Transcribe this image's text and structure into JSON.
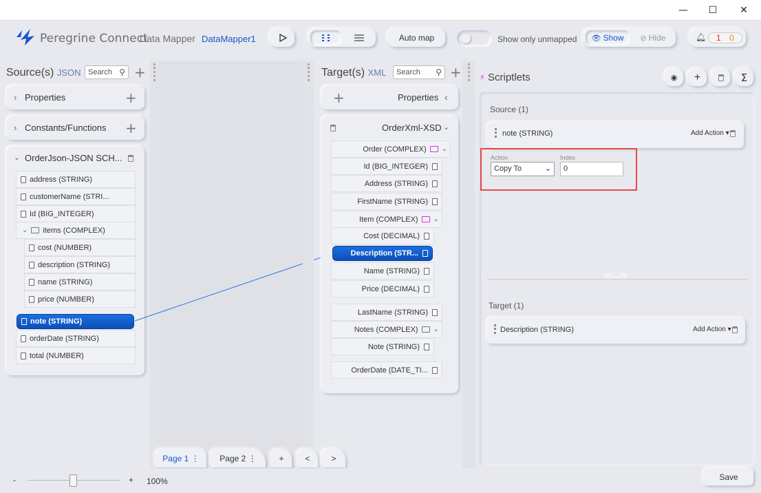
{
  "app": {
    "name": "Peregrine Connect",
    "module": "Data Mapper",
    "mapper_name": "DataMapper1"
  },
  "window_controls": {
    "minimize": "—",
    "maximize": "☐",
    "close": "✕"
  },
  "toolbar": {
    "auto_map_label": "Auto map",
    "show_only_unmapped_label": "Show only unmapped",
    "show_label": "Show",
    "hide_label": "Hide",
    "notif_red_count": "1",
    "notif_orange_count": "0"
  },
  "source": {
    "title": "Source(s)",
    "format": "JSON",
    "search_placeholder": "Search",
    "properties_label": "Properties",
    "constants_label": "Constants/Functions",
    "schema_label": "OrderJson-JSON SCH...",
    "items": [
      {
        "label": "address (STRING)"
      },
      {
        "label": "customerName (STRI..."
      },
      {
        "label": "Id (BIG_INTEGER)"
      },
      {
        "label": "items (COMPLEX)"
      },
      {
        "label": "cost (NUMBER)"
      },
      {
        "label": "description (STRING)"
      },
      {
        "label": "name (STRING)"
      },
      {
        "label": "price (NUMBER)"
      },
      {
        "label": "note (STRING)"
      },
      {
        "label": "orderDate (STRING)"
      },
      {
        "label": "total (NUMBER)"
      }
    ]
  },
  "target": {
    "title": "Target(s)",
    "format": "XML",
    "search_placeholder": "Search",
    "properties_label": "Properties",
    "schema_label": "OrderXml-XSD",
    "items": [
      {
        "label": "Order (COMPLEX)"
      },
      {
        "label": "Id (BIG_INTEGER)"
      },
      {
        "label": "Address (STRING)"
      },
      {
        "label": "FirstName (STRING)"
      },
      {
        "label": "Item (COMPLEX)"
      },
      {
        "label": "Cost (DECIMAL)"
      },
      {
        "label": "Description (STR..."
      },
      {
        "label": "Name (STRING)"
      },
      {
        "label": "Price (DECIMAL)"
      },
      {
        "label": "LastName (STRING)"
      },
      {
        "label": "Notes (COMPLEX)"
      },
      {
        "label": "Note (STRING)"
      },
      {
        "label": "OrderDate (DATE_TI..."
      }
    ]
  },
  "scriptlets": {
    "title": "Scriptlets",
    "source_header": "Source (1)",
    "source_field": "note (STRING)",
    "add_action_label": "Add Action",
    "action_label": "Action",
    "action_value": "Copy To",
    "index_label": "Index",
    "index_value": "0",
    "target_header": "Target (1)",
    "target_field": "Description (STRING)"
  },
  "pages": {
    "page1": "Page 1",
    "page2": "Page 2",
    "add": "+",
    "prev": "<",
    "next": ">"
  },
  "footer": {
    "zoom_minus": "-",
    "zoom_plus": "+",
    "zoom_value": "100%",
    "save_label": "Save"
  }
}
